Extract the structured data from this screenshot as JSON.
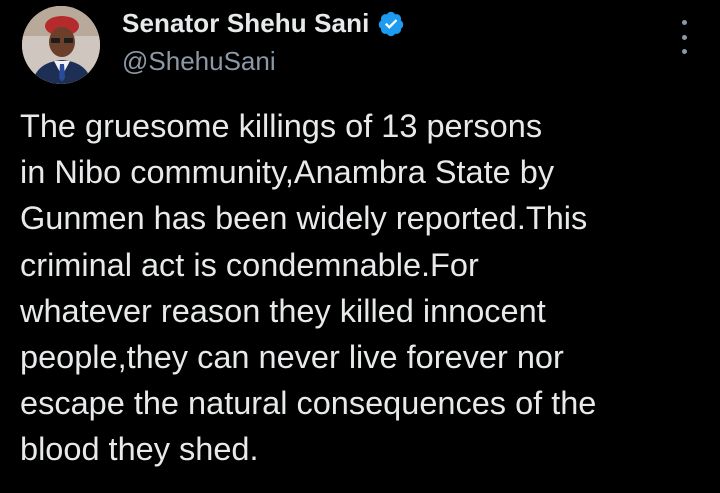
{
  "author": {
    "display_name": "Senator Shehu Sani",
    "handle": "@ShehuSani",
    "verified": true,
    "verified_color": "#1d9bf0"
  },
  "tweet": {
    "lines": [
      "The gruesome killings of 13 persons",
      "in Nibo community,Anambra State by",
      "Gunmen has been widely reported.This",
      "criminal act is condemnable.For",
      "whatever reason they killed innocent",
      "people,they can never live forever nor",
      "escape the natural consequences of the",
      "blood they shed."
    ]
  },
  "icons": {
    "avatar": "profile-photo",
    "verified": "verified-badge-icon",
    "more": "more-options-icon"
  },
  "colors": {
    "background": "#000000",
    "text": "#e7e9ea",
    "secondary_text": "#8b98a5",
    "accent": "#1d9bf0"
  }
}
